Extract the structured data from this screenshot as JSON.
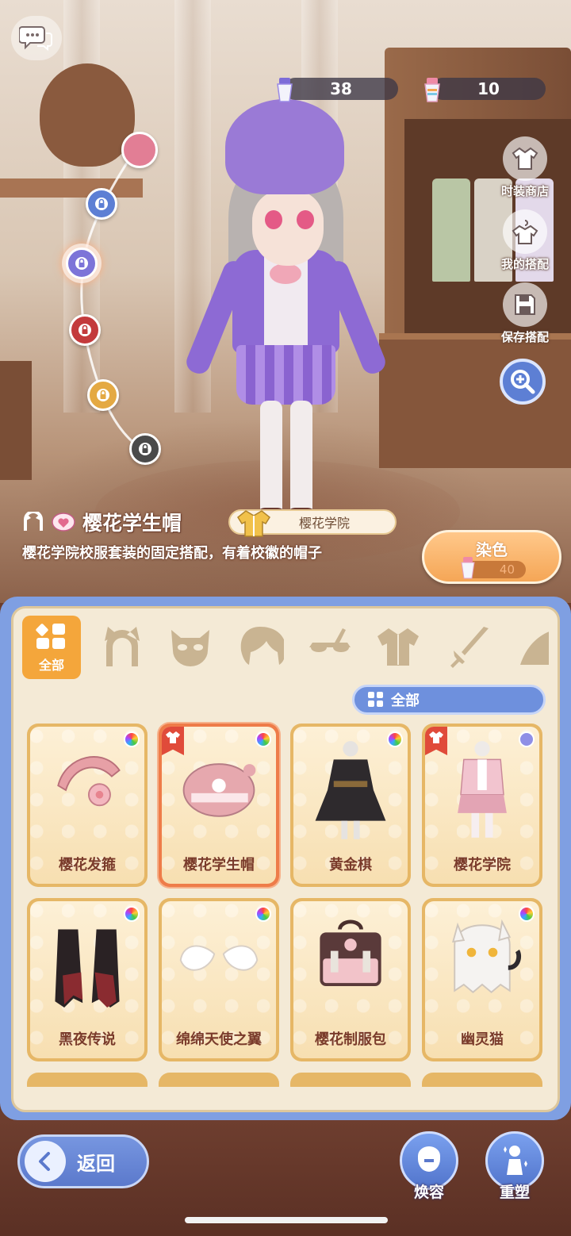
{
  "currency": {
    "primary_amount": "38",
    "secondary_amount": "10"
  },
  "side_menu": {
    "shop": "时装商店",
    "my_outfits": "我的搭配",
    "save_outfit": "保存搭配"
  },
  "unlock_track": {
    "dots": [
      {
        "color": "#e27e95",
        "locked": false
      },
      {
        "color": "#5d7fd4",
        "locked": true
      },
      {
        "color": "#7d74d8",
        "locked": true
      },
      {
        "color": "#c33a3c",
        "locked": true
      },
      {
        "color": "#e4a943",
        "locked": true
      },
      {
        "color": "#4a4a4a",
        "locked": true
      }
    ]
  },
  "item": {
    "name": "樱花学生帽",
    "set_name": "樱花学院",
    "description": "樱花学院校服套装的固定搭配，有着校徽的帽子"
  },
  "dye": {
    "label": "染色",
    "cost": "40"
  },
  "categories": {
    "all_label": "全部",
    "icons": [
      "cat-ears-icon",
      "mask-icon",
      "hair-icon",
      "glasses-icon",
      "outfit-icon",
      "sword-icon",
      "wing-icon"
    ]
  },
  "filter": {
    "label": "全部"
  },
  "items": [
    {
      "label": "樱花发箍",
      "new": false,
      "dye": "multi",
      "selected": false,
      "art": "headband"
    },
    {
      "label": "樱花学生帽",
      "new": true,
      "dye": "multi",
      "selected": true,
      "art": "beret"
    },
    {
      "label": "黄金棋",
      "new": false,
      "dye": "multi",
      "selected": false,
      "art": "black-dress"
    },
    {
      "label": "樱花学院",
      "new": true,
      "dye": "solid",
      "selected": false,
      "art": "pink-uniform"
    },
    {
      "label": "黑夜传说",
      "new": false,
      "dye": "multi",
      "selected": false,
      "art": "black-cape"
    },
    {
      "label": "绵绵天使之翼",
      "new": false,
      "dye": "multi",
      "selected": false,
      "art": "angel-wings"
    },
    {
      "label": "樱花制服包",
      "new": false,
      "dye": "none",
      "selected": false,
      "art": "school-bag"
    },
    {
      "label": "幽灵猫",
      "new": false,
      "dye": "multi",
      "selected": false,
      "art": "ghost-cat"
    }
  ],
  "bottom": {
    "back": "返回",
    "face": "焕容",
    "reshape": "重塑"
  }
}
